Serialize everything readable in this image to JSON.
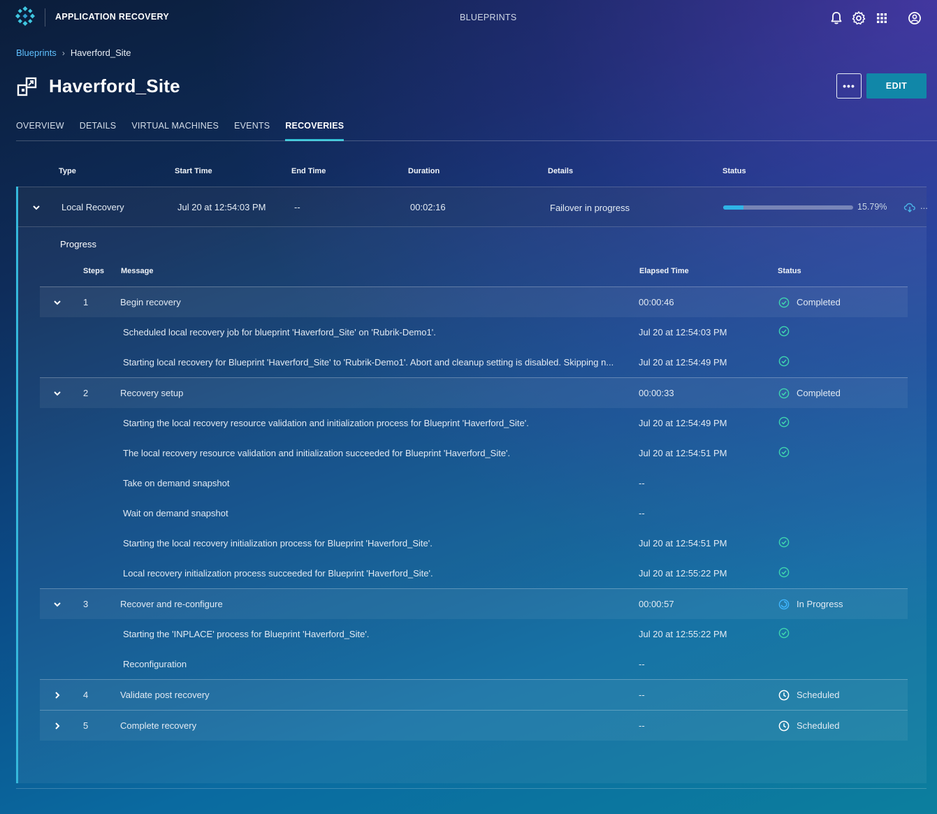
{
  "header": {
    "app_title": "APPLICATION RECOVERY",
    "center_nav": "BLUEPRINTS",
    "icons": [
      "bell-icon",
      "gear-icon",
      "app-grid-icon",
      "user-icon"
    ]
  },
  "breadcrumb": {
    "link": "Blueprints",
    "current": "Haverford_Site"
  },
  "page": {
    "title": "Haverford_Site",
    "more_label": "•••",
    "edit_label": "EDIT"
  },
  "tabs": [
    {
      "label": "OVERVIEW",
      "active": false
    },
    {
      "label": "DETAILS",
      "active": false
    },
    {
      "label": "VIRTUAL MACHINES",
      "active": false
    },
    {
      "label": "EVENTS",
      "active": false
    },
    {
      "label": "RECOVERIES",
      "active": true
    }
  ],
  "recoveries": {
    "columns": {
      "type": "Type",
      "start": "Start Time",
      "end": "End Time",
      "duration": "Duration",
      "details": "Details",
      "status": "Status"
    },
    "row": {
      "type": "Local Recovery",
      "start": "Jul 20 at 12:54:03 PM",
      "end": "--",
      "duration": "00:02:16",
      "details": "Failover in progress",
      "progress": 15.79,
      "progress_label": "15.79%",
      "trailing": "..."
    }
  },
  "progress": {
    "title": "Progress",
    "columns": {
      "steps": "Steps",
      "message": "Message",
      "elapsed": "Elapsed Time",
      "status": "Status"
    },
    "steps": [
      {
        "num": "1",
        "message": "Begin recovery",
        "elapsed": "00:00:46",
        "status": "Completed",
        "status_icon": "check-circle-icon",
        "expanded": true,
        "substeps": [
          {
            "message": "Scheduled local recovery job for blueprint 'Haverford_Site' on 'Rubrik-Demo1'.",
            "time": "Jul 20 at 12:54:03 PM",
            "done": true
          },
          {
            "message": "Starting local recovery for Blueprint 'Haverford_Site' to 'Rubrik-Demo1'. Abort and cleanup setting is disabled. Skipping n...",
            "time": "Jul 20 at 12:54:49 PM",
            "done": true
          }
        ]
      },
      {
        "num": "2",
        "message": "Recovery setup",
        "elapsed": "00:00:33",
        "status": "Completed",
        "status_icon": "check-circle-icon",
        "expanded": true,
        "substeps": [
          {
            "message": "Starting the local recovery resource validation and initialization process for Blueprint 'Haverford_Site'.",
            "time": "Jul 20 at 12:54:49 PM",
            "done": true
          },
          {
            "message": "The local recovery resource validation and initialization succeeded for Blueprint 'Haverford_Site'.",
            "time": "Jul 20 at 12:54:51 PM",
            "done": true
          },
          {
            "message": "Take on demand snapshot",
            "time": "--",
            "done": false
          },
          {
            "message": "Wait on demand snapshot",
            "time": "--",
            "done": false
          },
          {
            "message": "Starting the local recovery initialization process for Blueprint 'Haverford_Site'.",
            "time": "Jul 20 at 12:54:51 PM",
            "done": true
          },
          {
            "message": "Local recovery initialization process succeeded for Blueprint 'Haverford_Site'.",
            "time": "Jul 20 at 12:55:22 PM",
            "done": true
          }
        ]
      },
      {
        "num": "3",
        "message": "Recover and re-configure",
        "elapsed": "00:00:57",
        "status": "In Progress",
        "status_icon": "in-progress-icon",
        "expanded": true,
        "substeps": [
          {
            "message": "Starting the 'INPLACE' process for Blueprint 'Haverford_Site'.",
            "time": "Jul 20 at 12:55:22 PM",
            "done": true
          },
          {
            "message": "Reconfiguration",
            "time": "--",
            "done": false
          }
        ]
      },
      {
        "num": "4",
        "message": "Validate post recovery",
        "elapsed": "--",
        "status": "Scheduled",
        "status_icon": "clock-icon",
        "expanded": false,
        "substeps": []
      },
      {
        "num": "5",
        "message": "Complete recovery",
        "elapsed": "--",
        "status": "Scheduled",
        "status_icon": "clock-icon",
        "expanded": false,
        "substeps": []
      }
    ]
  },
  "colors": {
    "accent": "#34c3d6",
    "link": "#5fc0ff",
    "edit_button": "#1187a8",
    "check": "#3fd6b0",
    "in_progress": "#3fb6ff"
  }
}
